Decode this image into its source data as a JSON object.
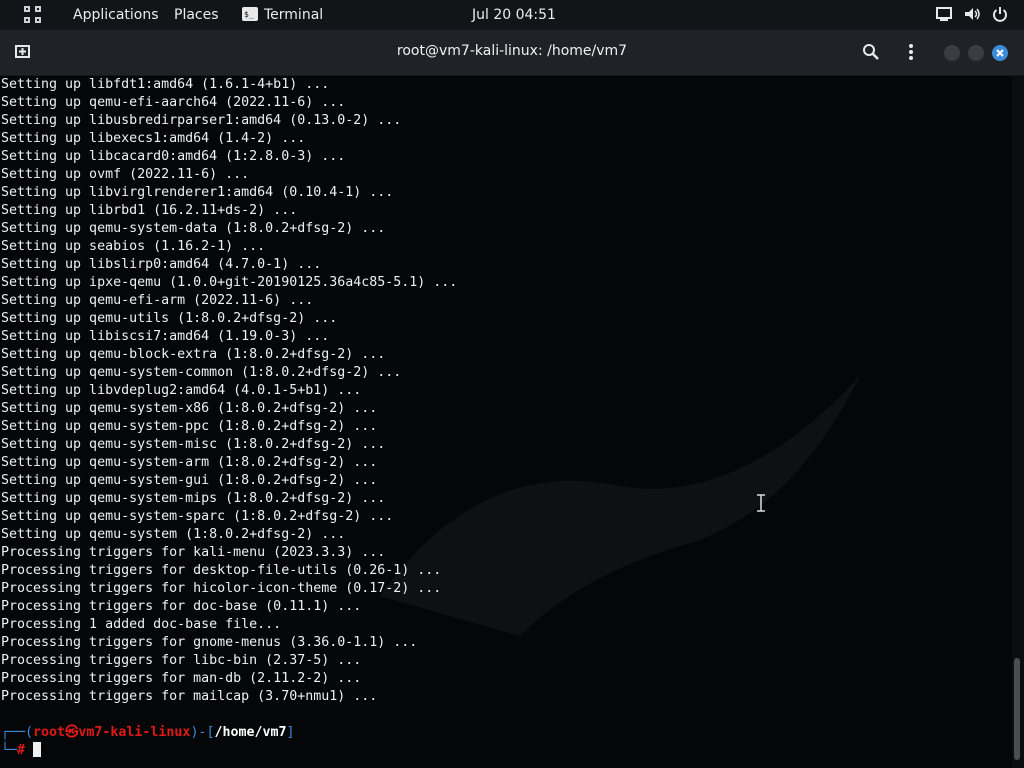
{
  "topbar": {
    "applications": "Applications",
    "places": "Places",
    "terminal": "Terminal",
    "clock": "Jul 20  04:51",
    "tray_icons": [
      "screen-icon",
      "volume-icon",
      "power-icon"
    ]
  },
  "window": {
    "title": "root@vm7-kali-linux: /home/vm7",
    "new_tab_icon": "new-tab-icon",
    "search_icon": "search-icon",
    "menu_icon": "kebab-menu-icon"
  },
  "terminal": {
    "lines": [
      "Setting up libfdt1:amd64 (1.6.1-4+b1) ...",
      "Setting up qemu-efi-aarch64 (2022.11-6) ...",
      "Setting up libusbredirparser1:amd64 (0.13.0-2) ...",
      "Setting up libexecs1:amd64 (1.4-2) ...",
      "Setting up libcacard0:amd64 (1:2.8.0-3) ...",
      "Setting up ovmf (2022.11-6) ...",
      "Setting up libvirglrenderer1:amd64 (0.10.4-1) ...",
      "Setting up librbd1 (16.2.11+ds-2) ...",
      "Setting up qemu-system-data (1:8.0.2+dfsg-2) ...",
      "Setting up seabios (1.16.2-1) ...",
      "Setting up libslirp0:amd64 (4.7.0-1) ...",
      "Setting up ipxe-qemu (1.0.0+git-20190125.36a4c85-5.1) ...",
      "Setting up qemu-efi-arm (2022.11-6) ...",
      "Setting up qemu-utils (1:8.0.2+dfsg-2) ...",
      "Setting up libiscsi7:amd64 (1.19.0-3) ...",
      "Setting up qemu-block-extra (1:8.0.2+dfsg-2) ...",
      "Setting up qemu-system-common (1:8.0.2+dfsg-2) ...",
      "Setting up libvdeplug2:amd64 (4.0.1-5+b1) ...",
      "Setting up qemu-system-x86 (1:8.0.2+dfsg-2) ...",
      "Setting up qemu-system-ppc (1:8.0.2+dfsg-2) ...",
      "Setting up qemu-system-misc (1:8.0.2+dfsg-2) ...",
      "Setting up qemu-system-arm (1:8.0.2+dfsg-2) ...",
      "Setting up qemu-system-gui (1:8.0.2+dfsg-2) ...",
      "Setting up qemu-system-mips (1:8.0.2+dfsg-2) ...",
      "Setting up qemu-system-sparc (1:8.0.2+dfsg-2) ...",
      "Setting up qemu-system (1:8.0.2+dfsg-2) ...",
      "Processing triggers for kali-menu (2023.3.3) ...",
      "Processing triggers for desktop-file-utils (0.26-1) ...",
      "Processing triggers for hicolor-icon-theme (0.17-2) ...",
      "Processing triggers for doc-base (0.11.1) ...",
      "Processing 1 added doc-base file...",
      "Processing triggers for gnome-menus (3.36.0-1.1) ...",
      "Processing triggers for libc-bin (2.37-5) ...",
      "Processing triggers for man-db (2.11.2-2) ...",
      "Processing triggers for mailcap (3.70+nmu1) ..."
    ],
    "prompt": {
      "user": "root",
      "at": "㉿",
      "host": "vm7-kali-linux",
      "path": "/home/vm7",
      "symbol": "#"
    }
  }
}
